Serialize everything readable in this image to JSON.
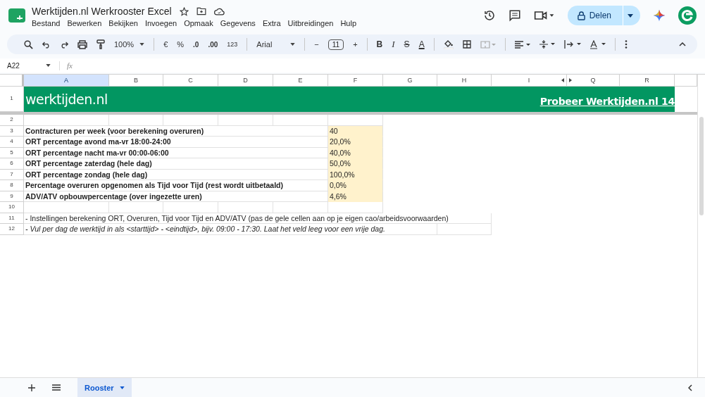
{
  "document": {
    "title": "Werktijden.nl Werkrooster Excel"
  },
  "menu": [
    "Bestand",
    "Bewerken",
    "Bekijken",
    "Invoegen",
    "Opmaak",
    "Gegevens",
    "Extra",
    "Uitbreidingen",
    "Hulp"
  ],
  "share_button": {
    "label": "Delen"
  },
  "toolbar": {
    "zoom": "100%",
    "currency": "€",
    "percent": "%",
    "decrease_decimals": ".0",
    "increase_decimals": ".00",
    "number_format": "123",
    "font": "Arial",
    "font_size": "11",
    "minus": "−",
    "plus": "+",
    "letters": [
      {
        "kind": "bold",
        "text": "B"
      },
      {
        "kind": "italic",
        "text": "I"
      },
      {
        "kind": "strike",
        "text": "S"
      },
      {
        "kind": "color",
        "text": "A"
      }
    ]
  },
  "name_box": "A22",
  "formula_label": "fx",
  "columns": [
    {
      "label": "A",
      "selected": true
    },
    {
      "label": "B",
      "selected": false
    },
    {
      "label": "C",
      "selected": false
    },
    {
      "label": "D",
      "selected": false
    },
    {
      "label": "E",
      "selected": false
    },
    {
      "label": "F",
      "selected": false
    },
    {
      "label": "G",
      "selected": false
    },
    {
      "label": "H",
      "selected": false
    },
    {
      "label": "I",
      "selected": false
    },
    {
      "label": "Q",
      "selected": false
    },
    {
      "label": "R",
      "selected": false
    }
  ],
  "banner": {
    "number": "1",
    "logo": "werktijden.nl",
    "link": "Probeer Werktijden.nl 14"
  },
  "rows": [
    {
      "number": "2",
      "kind": "blank"
    },
    {
      "number": "3",
      "kind": "setting",
      "label": "Contracturen per week (voor berekening overuren)",
      "value": "40"
    },
    {
      "number": "4",
      "kind": "setting",
      "label": "ORT percentage avond ma-vr 18:00-24:00",
      "value": "20,0%"
    },
    {
      "number": "5",
      "kind": "setting",
      "label": "ORT percentage nacht ma-vr 00:00-06:00",
      "value": "40,0%"
    },
    {
      "number": "6",
      "kind": "setting",
      "label": "ORT percentage zaterdag (hele dag)",
      "value": "50,0%"
    },
    {
      "number": "7",
      "kind": "setting",
      "label": "ORT percentage zondag (hele dag)",
      "value": "100,0%"
    },
    {
      "number": "8",
      "kind": "setting",
      "label": "Percentage overuren opgenomen als Tijd voor Tijd (rest wordt uitbetaald)",
      "value": "0,0%"
    },
    {
      "number": "9",
      "kind": "setting",
      "label": "ADV/ATV opbouwpercentage (over ingezette uren)",
      "value": "4,6%"
    },
    {
      "number": "10",
      "kind": "blank"
    },
    {
      "number": "11",
      "kind": "note",
      "text": "- Instellingen berekening ORT, Overuren, Tijd voor Tijd en ADV/ATV (pas de gele cellen aan op je eigen cao/arbeidsvoorwaarden)",
      "italic": false
    },
    {
      "number": "12",
      "kind": "note",
      "text": "- Vul per dag de werktijd in als <starttijd> - <eindtijd>, bijv. 09:00 - 17:30. Laat het veld leeg voor een vrije dag.",
      "italic": true
    }
  ],
  "sheet_tabs": [
    {
      "label": "Rooster",
      "selected": true
    }
  ]
}
